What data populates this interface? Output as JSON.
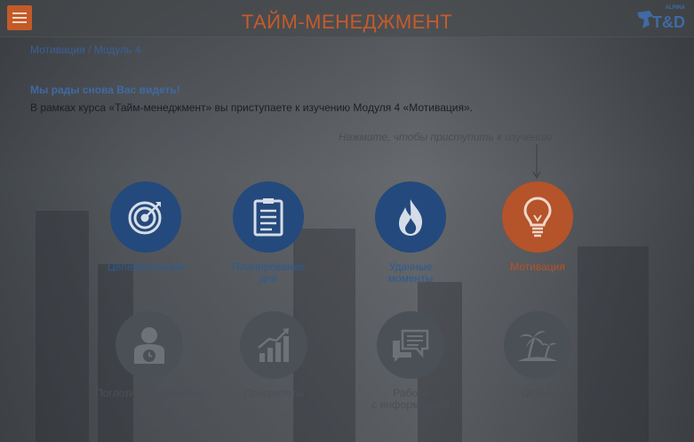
{
  "header": {
    "title": "ТАЙМ-МЕНЕДЖМЕНТ",
    "logo_top": "ALPINA",
    "logo_main": "T&D"
  },
  "breadcrumb": "Мотивация / Модуль 4",
  "greeting": "Мы рады снова Вас видеть!",
  "intro": "В рамках курса «Тайм-менеджмент» вы приступаете к изучению Модуля 4 «Мотивация».",
  "hint": "Нажмите, чтобы приступить к изучению",
  "modules_row1": [
    {
      "label": "Целеполагание",
      "icon": "target-icon",
      "state": "available"
    },
    {
      "label_line1": "Планирование",
      "label_line2": "дня",
      "icon": "clipboard-icon",
      "state": "available"
    },
    {
      "label_line1": "Удачные",
      "label_line2": "моменты",
      "icon": "flame-icon",
      "state": "available"
    },
    {
      "label": "Мотивация",
      "icon": "lightbulb-icon",
      "state": "current"
    }
  ],
  "modules_row2": [
    {
      "label": "Поглотители времени",
      "icon": "person-clock-icon",
      "state": "locked"
    },
    {
      "label": "Приоритеты",
      "icon": "growth-chart-icon",
      "state": "locked"
    },
    {
      "label_line1": "Работа",
      "label_line2": "с информацией",
      "icon": "chat-bubbles-icon",
      "state": "locked"
    },
    {
      "label": "Отдых",
      "icon": "palm-island-icon",
      "state": "locked"
    }
  ],
  "colors": {
    "accent_orange": "#c65a2a",
    "module_blue": "#24497c",
    "locked_grey": "#4b5056",
    "link_blue": "#3f6aa4"
  }
}
